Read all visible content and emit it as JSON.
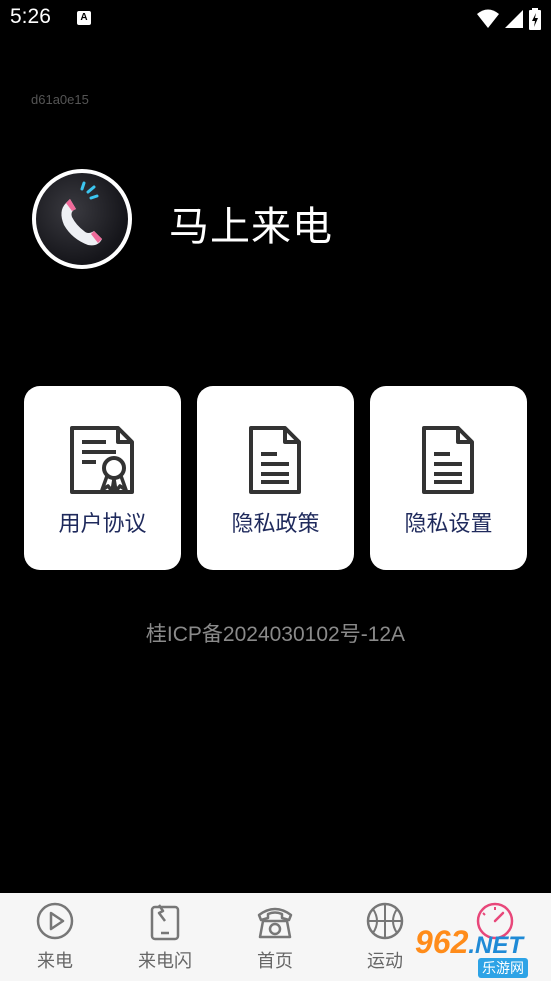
{
  "status_bar": {
    "time": "5:26",
    "notification_icon": "a-icon",
    "icons": [
      "wifi-icon",
      "signal-icon",
      "battery-icon"
    ]
  },
  "build_id": "d61a0e15",
  "app": {
    "name": "马上来电",
    "logo_icon": "phone-handset-icon"
  },
  "cards": [
    {
      "label": "用户协议",
      "icon": "certificate-document-icon"
    },
    {
      "label": "隐私政策",
      "icon": "document-icon"
    },
    {
      "label": "隐私设置",
      "icon": "document-icon"
    }
  ],
  "icp": "桂ICP备2024030102号-12A",
  "bottom_nav": [
    {
      "label": "来电",
      "icon": "play-circle-icon",
      "active": false
    },
    {
      "label": "来电闪",
      "icon": "flash-phone-icon",
      "active": false
    },
    {
      "label": "首页",
      "icon": "telephone-icon",
      "active": false
    },
    {
      "label": "运动",
      "icon": "basketball-icon",
      "active": false
    },
    {
      "label": "",
      "icon": "speedometer-icon",
      "active": true
    }
  ],
  "colors": {
    "background": "#000000",
    "card_background": "#ffffff",
    "card_text": "#1f2a5c",
    "active_tab": "#e8477a",
    "nav_background": "#f6f6f6"
  },
  "watermark": {
    "brand": "962",
    "suffix": ".NET",
    "sub": "乐游网"
  }
}
